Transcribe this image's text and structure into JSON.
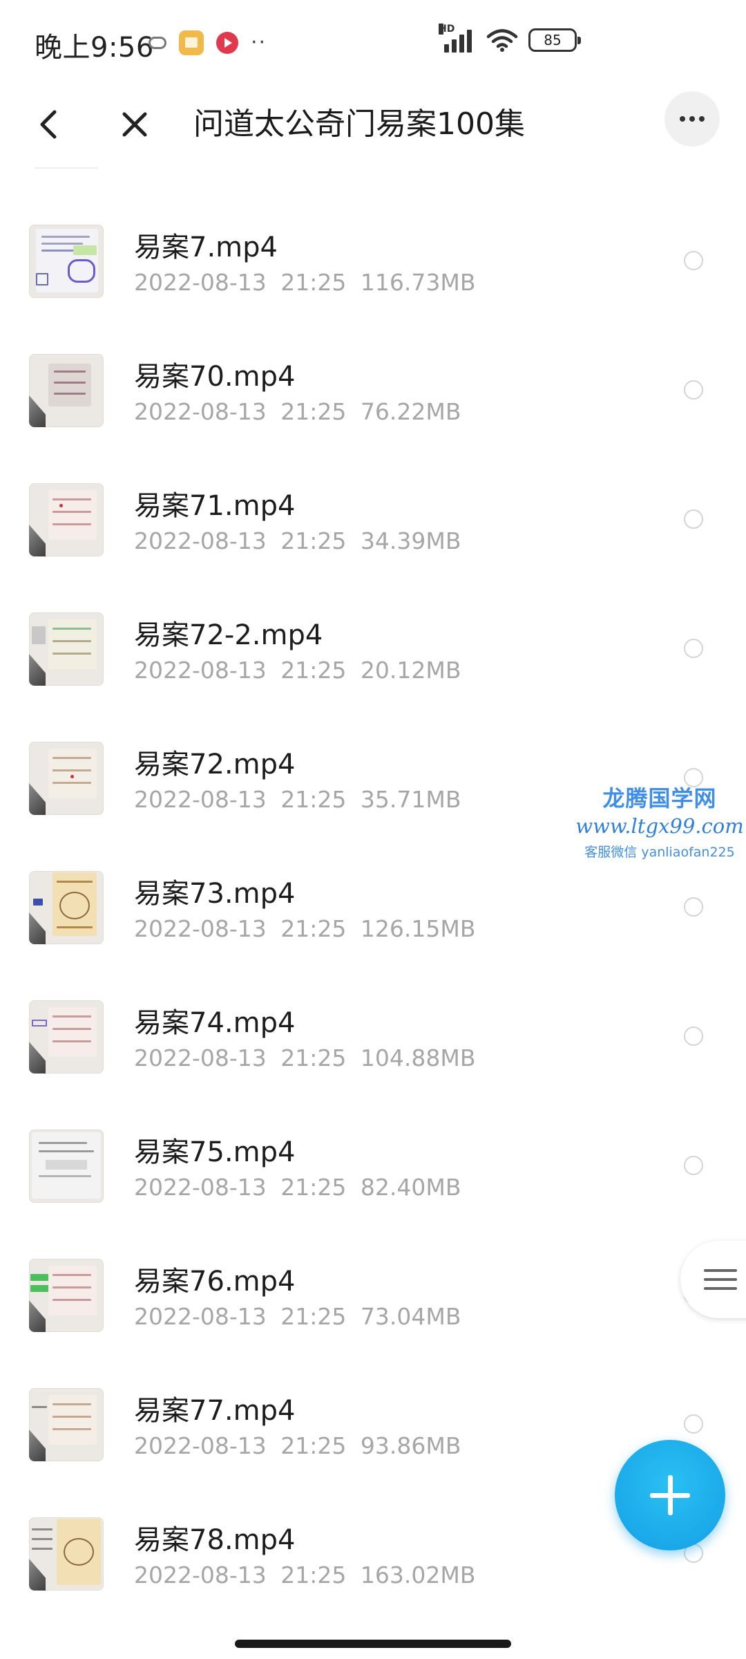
{
  "status_bar": {
    "time": "晚上9:56",
    "network": "HD",
    "battery": "85",
    "icons": [
      "cloud-icon",
      "app-notification-icon",
      "video-app-icon",
      "more-dots-icon",
      "signal-icon",
      "wifi-icon",
      "battery-icon"
    ]
  },
  "header": {
    "title": "问道太公奇门易案100集",
    "back_icon": "chevron-left-icon",
    "close_icon": "close-icon",
    "more_icon": "more-horizontal-icon"
  },
  "files": [
    {
      "name": "易案7.mp4",
      "date": "2022-08-13",
      "time": "21:25",
      "size": "116.73MB"
    },
    {
      "name": "易案70.mp4",
      "date": "2022-08-13",
      "time": "21:25",
      "size": "76.22MB"
    },
    {
      "name": "易案71.mp4",
      "date": "2022-08-13",
      "time": "21:25",
      "size": "34.39MB"
    },
    {
      "name": "易案72-2.mp4",
      "date": "2022-08-13",
      "time": "21:25",
      "size": "20.12MB"
    },
    {
      "name": "易案72.mp4",
      "date": "2022-08-13",
      "time": "21:25",
      "size": "35.71MB"
    },
    {
      "name": "易案73.mp4",
      "date": "2022-08-13",
      "time": "21:25",
      "size": "126.15MB"
    },
    {
      "name": "易案74.mp4",
      "date": "2022-08-13",
      "time": "21:25",
      "size": "104.88MB"
    },
    {
      "name": "易案75.mp4",
      "date": "2022-08-13",
      "time": "21:25",
      "size": "82.40MB"
    },
    {
      "name": "易案76.mp4",
      "date": "2022-08-13",
      "time": "21:25",
      "size": "73.04MB"
    },
    {
      "name": "易案77.mp4",
      "date": "2022-08-13",
      "time": "21:25",
      "size": "93.86MB"
    },
    {
      "name": "易案78.mp4",
      "date": "2022-08-13",
      "time": "21:25",
      "size": "163.02MB"
    }
  ],
  "watermark": {
    "title": "龙腾国学网",
    "url": "www.ltgx99.com",
    "service": "客服微信 yanliaofan225"
  },
  "colors": {
    "accent": "#1ea8ec",
    "meta_text": "#a6a6a6",
    "watermark": "#3f8fe8"
  },
  "fab_icon": "plus-icon",
  "side_handle_icon": "menu-lines-icon"
}
